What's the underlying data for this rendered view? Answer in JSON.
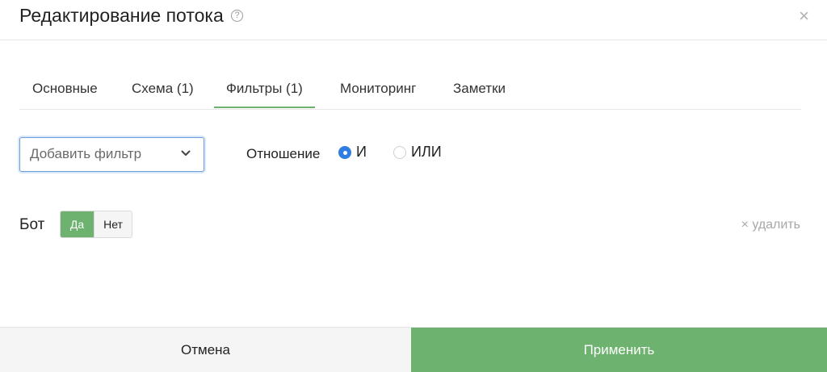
{
  "header": {
    "title": "Редактирование потока",
    "help_symbol": "?",
    "close_symbol": "×"
  },
  "tabs": [
    {
      "label": "Основные",
      "active": false
    },
    {
      "label": "Схема (1)",
      "active": false
    },
    {
      "label": "Фильтры (1)",
      "active": true
    },
    {
      "label": "Мониторинг",
      "active": false
    },
    {
      "label": "Заметки",
      "active": false
    }
  ],
  "filters": {
    "add_filter_placeholder": "Добавить фильтр",
    "relation_label": "Отношение",
    "relation_options": [
      {
        "label": "И",
        "checked": true
      },
      {
        "label": "ИЛИ",
        "checked": false
      }
    ]
  },
  "filter_row": {
    "label": "Бот",
    "yes_label": "Да",
    "no_label": "Нет",
    "selected": "Да",
    "remove_label": "× удалить"
  },
  "footer": {
    "cancel_label": "Отмена",
    "apply_label": "Применить"
  },
  "colors": {
    "accent_green": "#6db36f",
    "focus_blue": "#6d9fe0",
    "radio_blue": "#2f7de1"
  },
  "icons": {
    "help": "help-icon",
    "close": "close-icon",
    "dropdown": "chevron-down-icon"
  }
}
